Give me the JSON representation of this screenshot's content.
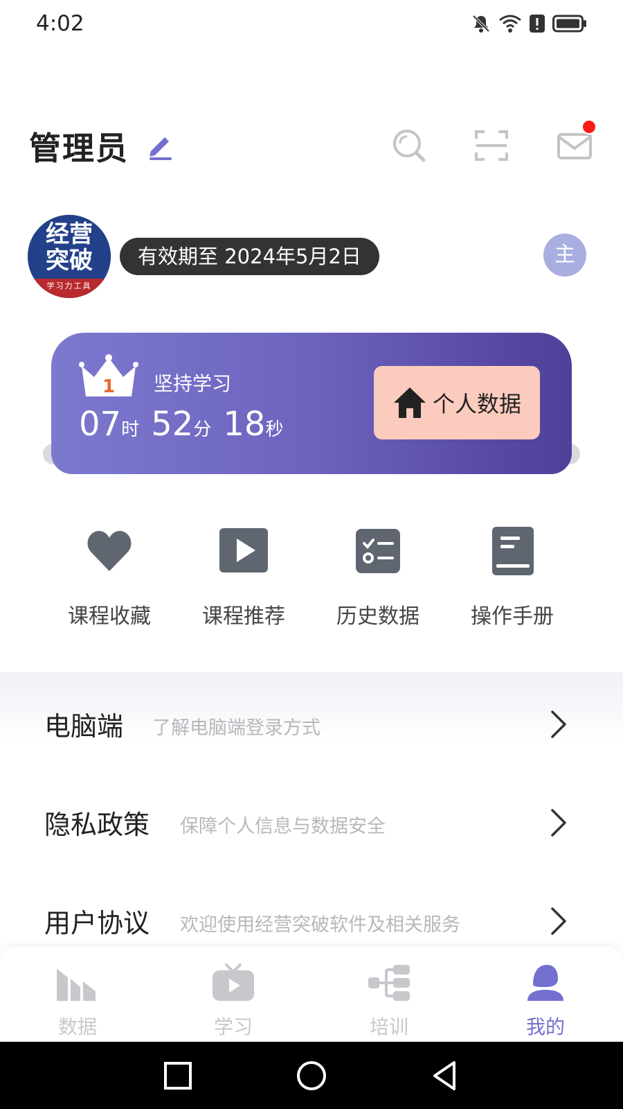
{
  "status_bar": {
    "time": "4:02",
    "icons": [
      "bell-muted-icon",
      "wifi-icon",
      "alert-icon",
      "battery-icon"
    ]
  },
  "header": {
    "title": "管理员",
    "icons": [
      "edit-icon",
      "search-icon",
      "scan-icon",
      "mail-icon"
    ],
    "mail_unread": true
  },
  "profile": {
    "avatar": {
      "line1": "经营",
      "line2": "突破",
      "tagline": "学习力工具"
    },
    "validity": "有效期至 2024年5月2日",
    "role_badge": "主"
  },
  "study_card": {
    "rank": "1",
    "label": "坚持学习",
    "hours": "07",
    "hours_unit": "时",
    "minutes": "52",
    "minutes_unit": "分",
    "seconds": "18",
    "seconds_unit": "秒",
    "personal_button": "个人数据"
  },
  "shortcuts": [
    {
      "label": "课程收藏",
      "icon": "heart-icon"
    },
    {
      "label": "课程推荐",
      "icon": "play-icon"
    },
    {
      "label": "历史数据",
      "icon": "checklist-icon"
    },
    {
      "label": "操作手册",
      "icon": "manual-icon"
    }
  ],
  "menu": [
    {
      "title": "电脑端",
      "subtitle": "了解电脑端登录方式"
    },
    {
      "title": "隐私政策",
      "subtitle": "保障个人信息与数据安全"
    },
    {
      "title": "用户协议",
      "subtitle": "欢迎使用经营突破软件及相关服务"
    }
  ],
  "tabs": [
    {
      "label": "数据",
      "icon": "data-icon",
      "active": false
    },
    {
      "label": "学习",
      "icon": "tv-icon",
      "active": false
    },
    {
      "label": "培训",
      "icon": "tree-icon",
      "active": false
    },
    {
      "label": "我的",
      "icon": "person-icon",
      "active": true
    }
  ],
  "colors": {
    "accent": "#7470cf",
    "card_start": "#7d79cf",
    "card_end": "#4f3f99",
    "personal_button": "#fbcbbd",
    "icon_gray": "#5f6670"
  }
}
